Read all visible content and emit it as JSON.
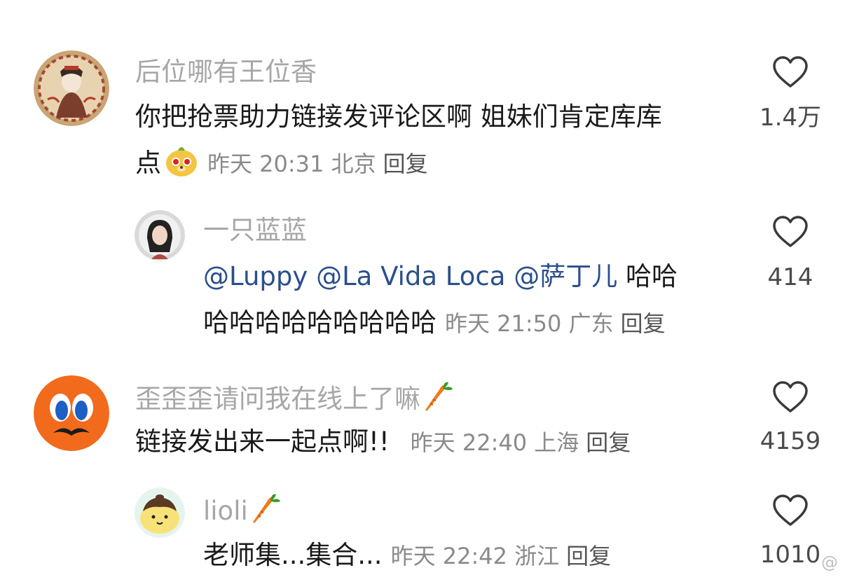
{
  "comments": [
    {
      "username": "后位哪有王位香",
      "text": "你把抢票助力链接发评论区啊 姐妹们肯定库库",
      "text_line2": "点",
      "emoji": "hamster-face-emoji",
      "time": "昨天 20:31",
      "location": "北京",
      "reply_label": "回复",
      "likes": "1.4万"
    },
    {
      "username": "一只蓝蓝",
      "mentions": [
        "@Luppy",
        "@La Vida Loca",
        "@萨丁儿"
      ],
      "text": "哈哈",
      "text_line2": "哈哈哈哈哈哈哈哈哈",
      "time": "昨天 21:50",
      "location": "广东",
      "reply_label": "回复",
      "likes": "414"
    },
    {
      "username": "歪歪歪请问我在线上了嘛",
      "badge": "carrot-icon",
      "text": "链接发出来一起点啊!!",
      "time": "昨天 22:40",
      "location": "上海",
      "reply_label": "回复",
      "likes": "4159"
    },
    {
      "username": "lioli",
      "badge": "carrot-icon",
      "text": "老师集...集合...",
      "time": "昨天 22:42",
      "location": "浙江",
      "reply_label": "回复",
      "likes": "1010"
    }
  ],
  "colors": {
    "username": "#a6a6a6",
    "mention": "#2b4f8c",
    "meta": "#8a8a8a",
    "body": "#1a1a1a"
  },
  "watermark": "@"
}
